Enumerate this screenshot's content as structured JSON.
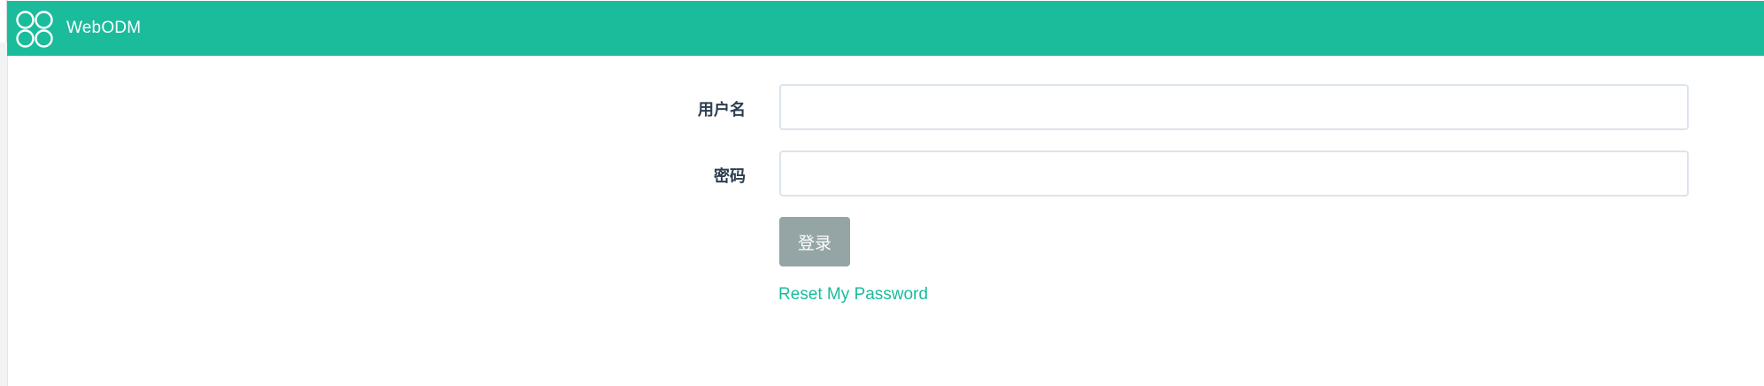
{
  "brand": {
    "name": "WebODM",
    "logo_icon": "webodm-drone-logo-icon"
  },
  "colors": {
    "navbar": "#1abc9c",
    "link": "#18bc9c",
    "button": "#95a5a6",
    "label": "#2c3e50"
  },
  "login_form": {
    "username_label": "用户名",
    "username_value": "",
    "password_label": "密码",
    "password_value": "",
    "submit_label": "登录",
    "reset_link": "Reset My Password"
  }
}
